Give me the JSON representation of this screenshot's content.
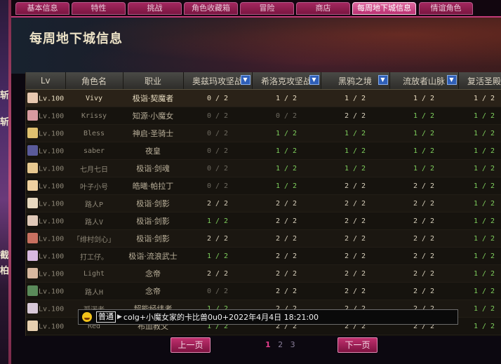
{
  "tabs": [
    {
      "label": "基本信息",
      "active": false
    },
    {
      "label": "特性",
      "active": false
    },
    {
      "label": "挑战",
      "active": false
    },
    {
      "label": "角色收藏箱",
      "active": false
    },
    {
      "label": "冒险",
      "active": false
    },
    {
      "label": "商店",
      "active": false
    },
    {
      "label": "每周地下城信息",
      "active": true
    },
    {
      "label": "情谊角色",
      "active": false
    }
  ],
  "side": {
    "frag1": "斩",
    "frag2": "斩",
    "frag3": "截",
    "frag4": "柏"
  },
  "header": {
    "title": "每周地下城信息"
  },
  "table": {
    "columns": [
      "Lv",
      "角色名",
      "职业",
      "奥兹玛攻坚战",
      "希洛克攻坚战",
      "黑鸦之境",
      "流放者山脉",
      "复活圣殿"
    ],
    "rows": [
      {
        "lv": "Lv.100",
        "name": "Vivy",
        "job": "极诣·契魔者",
        "c1": "0 / 2",
        "c2": "1 / 2",
        "c3": "1 / 2",
        "c4": "1 / 2",
        "c5": "1 / 2"
      },
      {
        "lv": "Lv.100",
        "name": "Krissy",
        "job": "知源·小魔女",
        "c1": "0 / 2",
        "c2": "0 / 2",
        "c3": "2 / 2",
        "c4": "1 / 2",
        "c5": "1 / 2"
      },
      {
        "lv": "Lv.100",
        "name": "Bless",
        "job": "神启·圣骑士",
        "c1": "0 / 2",
        "c2": "1 / 2",
        "c3": "1 / 2",
        "c4": "1 / 2",
        "c5": "1 / 2"
      },
      {
        "lv": "Lv.100",
        "name": "saber",
        "job": "夜皇",
        "c1": "0 / 2",
        "c2": "1 / 2",
        "c3": "1 / 2",
        "c4": "1 / 2",
        "c5": "1 / 2"
      },
      {
        "lv": "Lv.100",
        "name": "七月七日",
        "job": "极诣·剑魂",
        "c1": "0 / 2",
        "c2": "1 / 2",
        "c3": "1 / 2",
        "c4": "1 / 2",
        "c5": "1 / 2"
      },
      {
        "lv": "Lv.100",
        "name": "叶子小号",
        "job": "皓曦·帕拉丁",
        "c1": "0 / 2",
        "c2": "1 / 2",
        "c3": "2 / 2",
        "c4": "2 / 2",
        "c5": "1 / 2"
      },
      {
        "lv": "Lv.100",
        "name": "路人P",
        "job": "极诣·剑影",
        "c1": "2 / 2",
        "c2": "2 / 2",
        "c3": "2 / 2",
        "c4": "2 / 2",
        "c5": "1 / 2"
      },
      {
        "lv": "Lv.100",
        "name": "路人V",
        "job": "极诣·剑影",
        "c1": "1 / 2",
        "c2": "2 / 2",
        "c3": "2 / 2",
        "c4": "2 / 2",
        "c5": "1 / 2"
      },
      {
        "lv": "Lv.100",
        "name": "「绯村剑心」",
        "job": "极诣·剑影",
        "c1": "2 / 2",
        "c2": "2 / 2",
        "c3": "2 / 2",
        "c4": "2 / 2",
        "c5": "1 / 2"
      },
      {
        "lv": "Lv.100",
        "name": "打工仔。",
        "job": "极诣·流浪武士",
        "c1": "1 / 2",
        "c2": "2 / 2",
        "c3": "2 / 2",
        "c4": "2 / 2",
        "c5": "1 / 2"
      },
      {
        "lv": "Lv.100",
        "name": "Light",
        "job": "念帝",
        "c1": "2 / 2",
        "c2": "2 / 2",
        "c3": "2 / 2",
        "c4": "2 / 2",
        "c5": "1 / 2"
      },
      {
        "lv": "Lv.100",
        "name": "路人H",
        "job": "念帝",
        "c1": "0 / 2",
        "c2": "2 / 2",
        "c3": "2 / 2",
        "c4": "2 / 2",
        "c5": "1 / 2"
      },
      {
        "lv": "Lv.100",
        "name": "孤渃者",
        "job": "超能经纬者",
        "c1": "1 / 2",
        "c2": "2 / 2",
        "c3": "2 / 2",
        "c4": "2 / 2",
        "c5": "1 / 2"
      },
      {
        "lv": "Lv.100",
        "name": "Red",
        "job": "布血教父",
        "c1": "1 / 2",
        "c2": "2 / 2",
        "c3": "2 / 2",
        "c4": "2 / 2",
        "c5": "1 / 2"
      }
    ]
  },
  "chat": {
    "channel": "普通",
    "message": "colg+小魔女家的卡比兽0u0+2022年4月4日 18:21:00"
  },
  "pagination": {
    "prev_label": "上一页",
    "next_label": "下一页",
    "pages": [
      "1",
      "2",
      "3"
    ],
    "current": "1"
  },
  "colors": {
    "tab_active": "#e06aa0",
    "tab": "#a3275f",
    "ratio_complete": "#d7cfbb",
    "ratio_partial": "#7ecf5c",
    "ratio_zero": "#6e6a60"
  }
}
